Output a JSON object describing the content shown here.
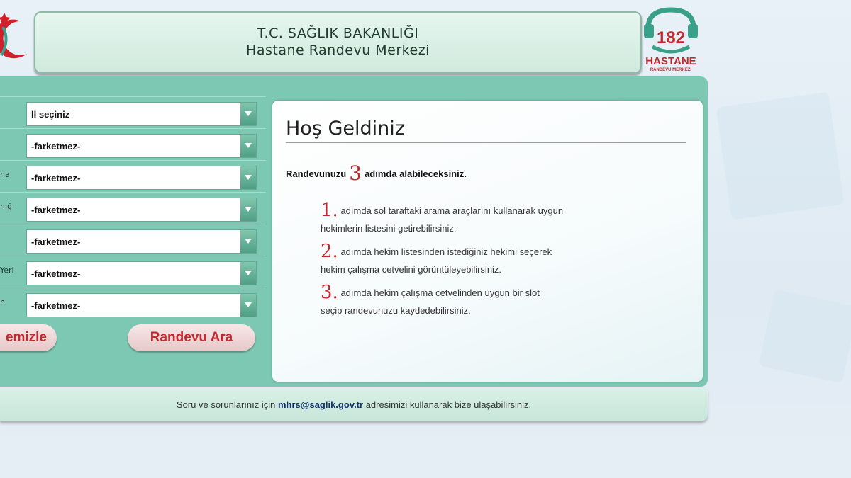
{
  "header": {
    "line1": "T.C. SAĞLIK BAKANLIĞI",
    "line2": "Hastane Randevu Merkezi",
    "right_logo_number": "182",
    "right_logo_brand": "HASTANE",
    "right_logo_sub": "RANDEVU MERKEZİ"
  },
  "form": {
    "rows": [
      {
        "label": "",
        "value": "İl seçiniz"
      },
      {
        "label": "",
        "value": "-farketmez-"
      },
      {
        "label": "na",
        "value": "-farketmez-"
      },
      {
        "label": "nığı",
        "value": "-farketmez-"
      },
      {
        "label": "",
        "value": "-farketmez-"
      },
      {
        "label": "Yeri",
        "value": "-farketmez-"
      },
      {
        "label": "n",
        "value": "-farketmez-"
      }
    ],
    "clear_label": "emizle",
    "search_label": "Randevu Ara"
  },
  "welcome": {
    "title": "Hoş Geldiniz",
    "intro_before": "Randevunuzu",
    "intro_number": "3",
    "intro_after": "adımda alabileceksiniz.",
    "steps": [
      {
        "num": "1.",
        "text_line1": "adımda sol taraftaki arama araçlarını kullanarak uygun",
        "text_line2": "hekimlerin listesini getirebilirsiniz."
      },
      {
        "num": "2.",
        "text_line1": "adımda hekim listesinden istediğiniz hekimi seçerek",
        "text_line2": "hekim çalışma cetvelini görüntüleyebilirsiniz."
      },
      {
        "num": "3.",
        "text_line1": "adımda hekim çalışma cetvelinden uygun bir slot",
        "text_line2": "seçip randevunuzu kaydedebilirsiniz."
      }
    ]
  },
  "footer": {
    "before": "Soru ve sorunlarınız için",
    "email": "mhrs@saglik.gov.tr",
    "after": "adresimizi kullanarak bize ulaşabilirsiniz."
  },
  "colors": {
    "panel": "#7dc8b2",
    "accent_red": "#c6262b",
    "header_bg": "#dff2e8"
  }
}
